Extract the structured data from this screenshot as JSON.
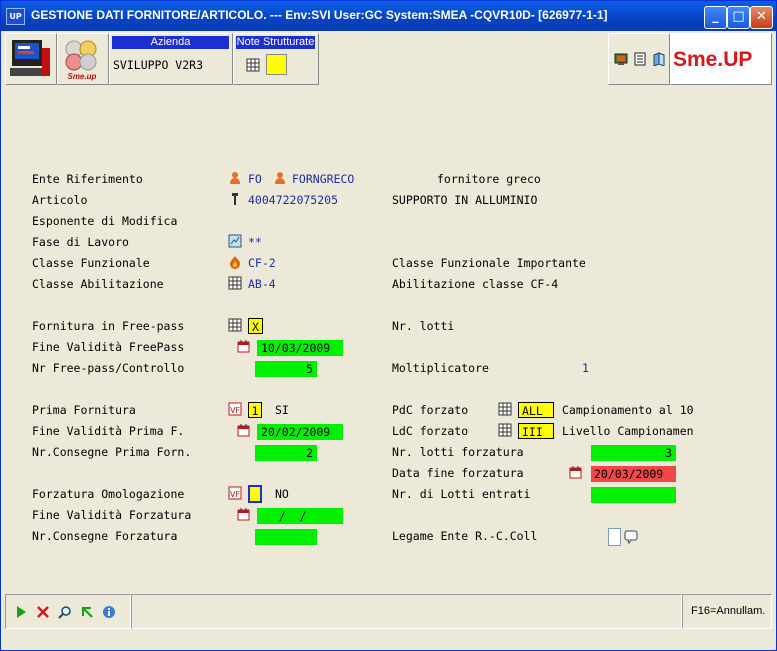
{
  "window": {
    "icon_text": "UP",
    "title": "GESTIONE DATI FORNITORE/ARTICOLO.  --- Env:SVI User:GC System:SMEA -CQVR10D- [626977-1-1]",
    "minimize": "_",
    "maximize": "□",
    "close": "✕"
  },
  "toolbar": {
    "logo_text": "Sme.up",
    "azienda_header": "Azienda",
    "azienda_value": "SVILUPPO V2R3",
    "note_header": "Note Strutturate",
    "brand_text": "Sme.UP"
  },
  "form": {
    "ente_label": "Ente Riferimento",
    "ente_type": "FO",
    "ente_code": "FORNGRECO",
    "ente_desc": "fornitore greco",
    "articolo_label": "Articolo",
    "articolo_code": "4004722075205",
    "articolo_desc": "SUPPORTO IN ALLUMINIO",
    "esponente_label": "Esponente di Modifica",
    "fase_label": "Fase di Lavoro",
    "fase_value": "**",
    "classe_funz_label": "Classe Funzionale",
    "classe_funz_value": "CF-2",
    "classe_funz_desc": "Classe Funzionale Importante",
    "classe_abil_label": "Classe Abilitazione",
    "classe_abil_value": "AB-4",
    "classe_abil_desc": "Abilitazione classe CF-4",
    "free_pass_label": "Fornitura in Free-pass",
    "free_pass_value": "X",
    "nr_lotti_label": "Nr. lotti",
    "fine_free_label": "Fine Validità FreePass",
    "fine_free_value": "10/03/2009",
    "nr_free_label": "Nr Free-pass/Controllo",
    "nr_free_value": "5",
    "moltiplicatore_label": "Moltiplicatore",
    "moltiplicatore_value": "1",
    "prima_forn_label": "Prima Fornitura",
    "prima_forn_value": "1",
    "prima_forn_desc": "SI",
    "pdc_label": "PdC forzato",
    "pdc_value": "ALL",
    "pdc_desc": "Campionamento al 10",
    "fine_prima_label": "Fine Validità Prima F.",
    "fine_prima_value": "20/02/2009",
    "ldc_label": "LdC forzato",
    "ldc_value": "III",
    "ldc_desc": "Livello Campionamen",
    "nr_cons_prima_label": "Nr.Consegne Prima Forn.",
    "nr_cons_prima_value": "2",
    "nr_lotti_forz_label": "Nr. lotti forzatura",
    "nr_lotti_forz_value": "3",
    "data_fine_forz_label": "Data fine forzatura",
    "data_fine_forz_value": "20/03/2009",
    "forz_omol_label": "Forzatura Omologazione",
    "forz_omol_value": "",
    "forz_omol_desc": "NO",
    "nr_lotti_entr_label": "Nr. di Lotti entrati",
    "fine_forz_label": "Fine Validità Forzatura",
    "fine_forz_value": "  /  /",
    "nr_cons_forz_label": "Nr.Consegne Forzatura",
    "legame_label": "Legame Ente R.-C.Coll"
  },
  "statusbar": {
    "f16_label": "F16=Annullam."
  },
  "colors": {
    "green_field": "#00f000",
    "yellow_field": "#ffff00",
    "red_field": "#f04848",
    "value_blue": "#1c2ba8",
    "title_blue": "#0843c4"
  }
}
